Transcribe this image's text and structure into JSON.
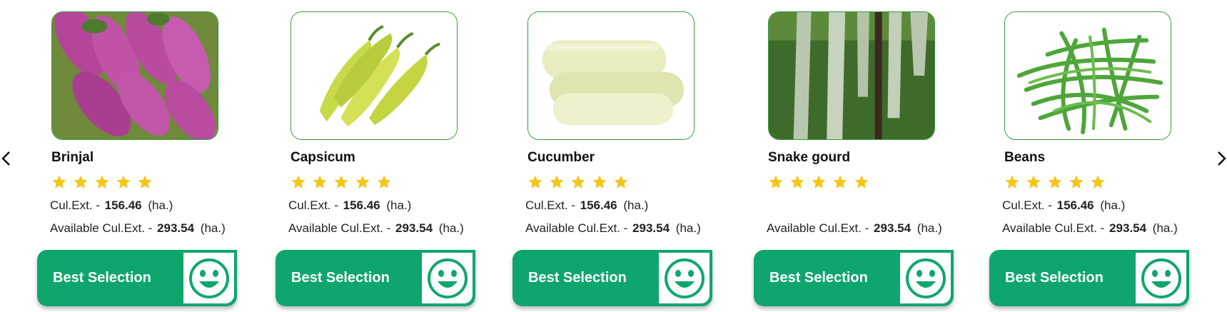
{
  "carousel": {
    "prev_icon": "chevron-left-icon",
    "next_icon": "chevron-right-icon",
    "cards": [
      {
        "name": "Brinjal",
        "rating": 5,
        "cul_label": "Cul.Ext. -",
        "cul_value": "156.46",
        "cul_unit": "(ha.)",
        "avail_label": "Available Cul.Ext. -",
        "avail_value": "293.54",
        "avail_unit": "(ha.)",
        "button_label": "Best Selection",
        "button_icon": "smiley-icon"
      },
      {
        "name": "Capsicum",
        "rating": 5,
        "cul_label": "Cul.Ext. -",
        "cul_value": "156.46",
        "cul_unit": "(ha.)",
        "avail_label": "Available Cul.Ext. -",
        "avail_value": "293.54",
        "avail_unit": "(ha.)",
        "button_label": "Best Selection",
        "button_icon": "smiley-icon"
      },
      {
        "name": "Cucumber",
        "rating": 5,
        "cul_label": "Cul.Ext. -",
        "cul_value": "156.46",
        "cul_unit": "(ha.)",
        "avail_label": "Available Cul.Ext. -",
        "avail_value": "293.54",
        "avail_unit": "(ha.)",
        "button_label": "Best Selection",
        "button_icon": "smiley-icon"
      },
      {
        "name": "Snake gourd",
        "rating": 5,
        "avail_label": "Available Cul.Ext. -",
        "avail_value": "293.54",
        "avail_unit": "(ha.)",
        "button_label": "Best Selection",
        "button_icon": "smiley-icon"
      },
      {
        "name": "Beans",
        "rating": 5,
        "cul_label": "Cul.Ext. -",
        "cul_value": "156.46",
        "cul_unit": "(ha.)",
        "avail_label": "Available Cul.Ext. -",
        "avail_value": "293.54",
        "avail_unit": "(ha.)",
        "button_label": "Best Selection",
        "button_icon": "smiley-icon"
      }
    ]
  },
  "colors": {
    "accent_green": "#0fa66d",
    "image_border": "#2e9b3c",
    "star": "#f5c518"
  }
}
